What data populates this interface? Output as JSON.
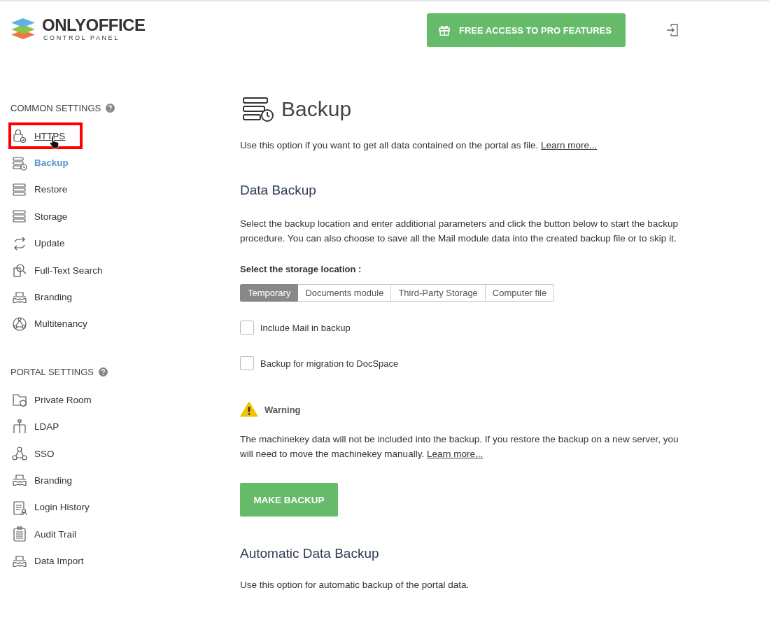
{
  "logo": {
    "name": "ONLYOFFICE",
    "subtitle": "CONTROL PANEL"
  },
  "promo_button": "FREE ACCESS TO PRO FEATURES",
  "sidebar": [
    {
      "heading": "COMMON SETTINGS",
      "items": [
        {
          "label": "HTTPS",
          "selected": false,
          "highlighted": true
        },
        {
          "label": "Backup",
          "selected": true,
          "highlighted": false
        },
        {
          "label": "Restore",
          "selected": false,
          "highlighted": false
        },
        {
          "label": "Storage",
          "selected": false,
          "highlighted": false
        },
        {
          "label": "Update",
          "selected": false,
          "highlighted": false
        },
        {
          "label": "Full-Text Search",
          "selected": false,
          "highlighted": false
        },
        {
          "label": "Branding",
          "selected": false,
          "highlighted": false
        },
        {
          "label": "Multitenancy",
          "selected": false,
          "highlighted": false
        }
      ]
    },
    {
      "heading": "PORTAL SETTINGS",
      "items": [
        {
          "label": "Private Room",
          "selected": false,
          "highlighted": false
        },
        {
          "label": "LDAP",
          "selected": false,
          "highlighted": false
        },
        {
          "label": "SSO",
          "selected": false,
          "highlighted": false
        },
        {
          "label": "Branding",
          "selected": false,
          "highlighted": false
        },
        {
          "label": "Login History",
          "selected": false,
          "highlighted": false
        },
        {
          "label": "Audit Trail",
          "selected": false,
          "highlighted": false
        },
        {
          "label": "Data Import",
          "selected": false,
          "highlighted": false
        }
      ]
    }
  ],
  "page_title": "Backup",
  "intro": "Use this option if you want to get all data contained on the portal as file.",
  "intro_link": "Learn more...",
  "data_backup": {
    "heading": "Data Backup",
    "description": "Select the backup location and enter additional parameters and click the button below to start the backup procedure. You can also choose to save all the Mail module data into the created backup file or to skip it.",
    "storage_label": "Select the storage location :",
    "storage_tabs": [
      {
        "label": "Temporary",
        "selected": true
      },
      {
        "label": "Documents module",
        "selected": false
      },
      {
        "label": "Third-Party Storage",
        "selected": false
      },
      {
        "label": "Computer file",
        "selected": false
      }
    ],
    "options": [
      {
        "label": "Include Mail in backup",
        "checked": false
      },
      {
        "label": "Backup for migration to DocSpace",
        "checked": false
      }
    ],
    "warning_title": "Warning",
    "warning_text": "The machinekey data will not be included into the backup. If you restore the backup on a new server, you will need to move the machinekey manually.",
    "warning_link": "Learn more...",
    "button": "MAKE BACKUP"
  },
  "automatic_backup": {
    "heading": "Automatic Data Backup",
    "description": "Use this option for automatic backup of the portal data."
  }
}
